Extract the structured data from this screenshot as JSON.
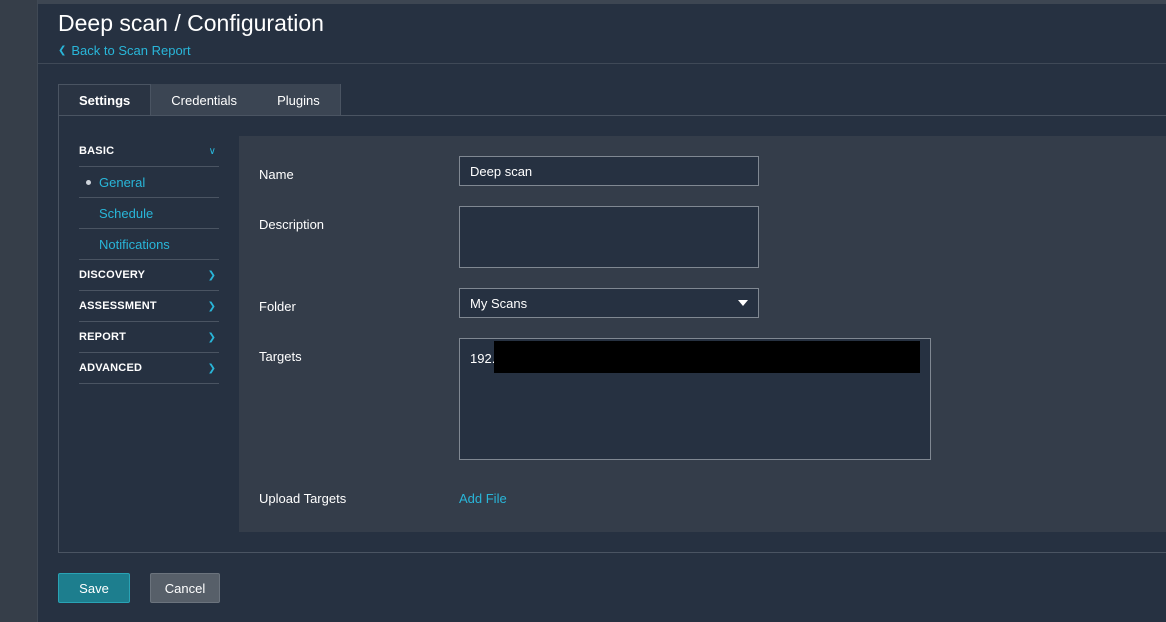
{
  "header": {
    "title": "Deep scan / Configuration",
    "back_link": "Back to Scan Report"
  },
  "tabs": [
    {
      "label": "Settings",
      "active": true
    },
    {
      "label": "Credentials",
      "active": false
    },
    {
      "label": "Plugins",
      "active": false
    }
  ],
  "sidenav": {
    "sections": [
      {
        "label": "BASIC",
        "expanded": true,
        "items": [
          "General",
          "Schedule",
          "Notifications"
        ],
        "selected": "General"
      },
      {
        "label": "DISCOVERY",
        "expanded": false
      },
      {
        "label": "ASSESSMENT",
        "expanded": false
      },
      {
        "label": "REPORT",
        "expanded": false
      },
      {
        "label": "ADVANCED",
        "expanded": false
      }
    ]
  },
  "form": {
    "name_label": "Name",
    "name_value": "Deep scan",
    "description_label": "Description",
    "description_value": "",
    "folder_label": "Folder",
    "folder_value": "My Scans",
    "targets_label": "Targets",
    "targets_value": "192.",
    "upload_label": "Upload Targets",
    "add_file": "Add File"
  },
  "buttons": {
    "save": "Save",
    "cancel": "Cancel"
  },
  "colors": {
    "accent": "#29b6d9",
    "background": "#263141",
    "form_bg": "#343d4a",
    "save_button": "#1d7e8e"
  }
}
